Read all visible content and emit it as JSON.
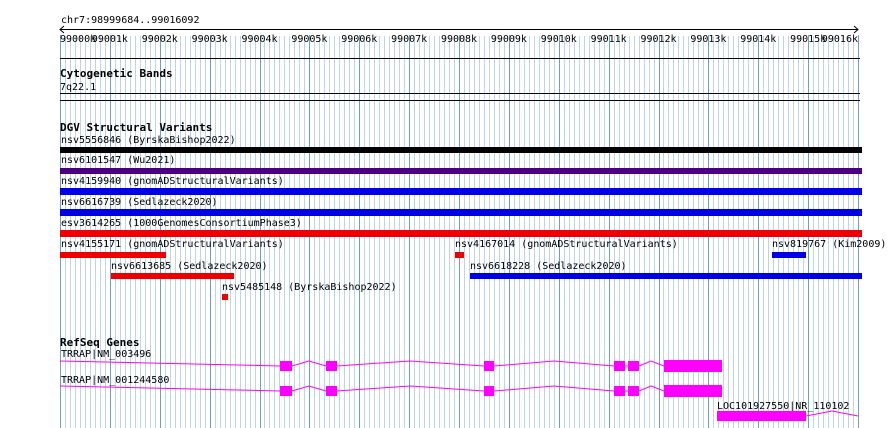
{
  "ruler": {
    "region": "chr7:98999684..99016092",
    "ticks": [
      "99000k",
      "99001k",
      "99002k",
      "99003k",
      "99004k",
      "99005k",
      "99006k",
      "99007k",
      "99008k",
      "99009k",
      "99010k",
      "99011k",
      "99012k",
      "99013k",
      "99014k",
      "99015k",
      "99016k"
    ]
  },
  "cytoband": {
    "title": "Cytogenetic Bands",
    "band": "7q22.1"
  },
  "dgv": {
    "title": "DGV Structural Variants",
    "variants": [
      {
        "label": "nsv5556846 (ByrskaBishop2022)",
        "color": "#000000"
      },
      {
        "label": "nsv6101547 (Wu2021)",
        "color": "#4b0082"
      },
      {
        "label": "nsv4159940 (gnomADStructuralVariants)",
        "color": "#0000e6"
      },
      {
        "label": "nsv6616739 (Sedlazeck2020)",
        "color": "#0000e6"
      },
      {
        "label": "esv3614265 (1000GenomesConsortiumPhase3)",
        "color": "#ee0000"
      },
      {
        "label": "nsv4155171 (gnomADStructuralVariants)",
        "color": "#ee0000"
      },
      {
        "label": "nsv4167014 (gnomADStructuralVariants)",
        "color": "#ee0000"
      },
      {
        "label": "nsv819767 (Kim2009)",
        "color": "#0000e6"
      },
      {
        "label": "nsv6613685 (Sedlazeck2020)",
        "color": "#ee0000"
      },
      {
        "label": "nsv6618228 (Sedlazeck2020)",
        "color": "#0000e6"
      },
      {
        "label": "nsv5485148 (ByrskaBishop2022)",
        "color": "#ee0000"
      }
    ]
  },
  "refseq": {
    "title": "RefSeq Genes",
    "genes": [
      {
        "label": "TRRAP|NM_003496",
        "color": "#ff00ff"
      },
      {
        "label": "TRRAP|NM_001244580",
        "color": "#ff00ff"
      },
      {
        "label": "LOC101927550|NR_110102",
        "color": "#ff00ff"
      }
    ]
  },
  "colors": {
    "grid_major": "#6fa0c0",
    "grid_minor": "#bcd6e6",
    "ruler": "#000000"
  }
}
